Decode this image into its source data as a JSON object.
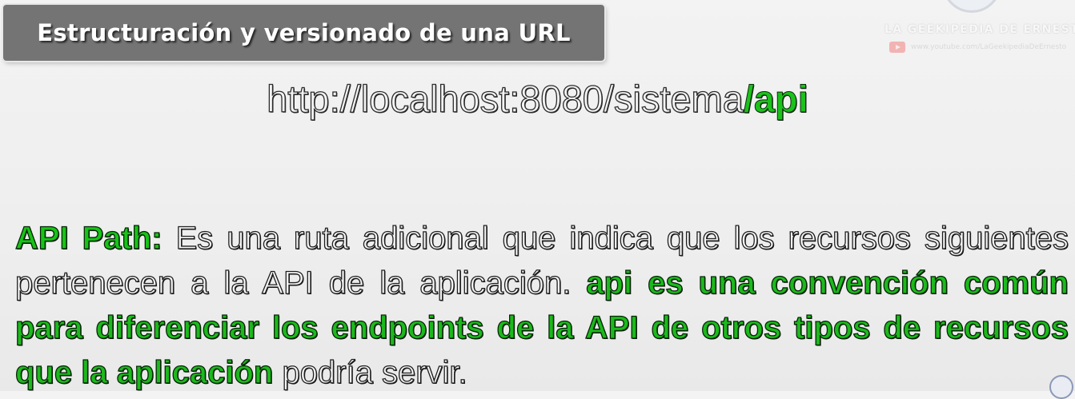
{
  "title": "Estructuración y versionado de una URL",
  "watermark": {
    "brand": "LA GEEKIPEDIA DE ERNESTO",
    "youtube_url": "www.youtube.com/LaGeekipediaDeErnesto",
    "icon": "youtube-icon"
  },
  "url": {
    "base": "http://localhost:8080/sistema",
    "highlight": "/api"
  },
  "paragraph": {
    "term": "API Path:",
    "text1": " Es una ruta adicional que indica que los recursos siguientes pertenecen a la API de la aplicación. ",
    "highlight": "api es una convención común para diferenciar los endpoints de la API de otros tipos de recursos que la aplicación",
    "text2": " podría servir."
  },
  "colors": {
    "accent_green": "#1bc21b",
    "banner_gray": "#747474",
    "background": "#efefef"
  }
}
